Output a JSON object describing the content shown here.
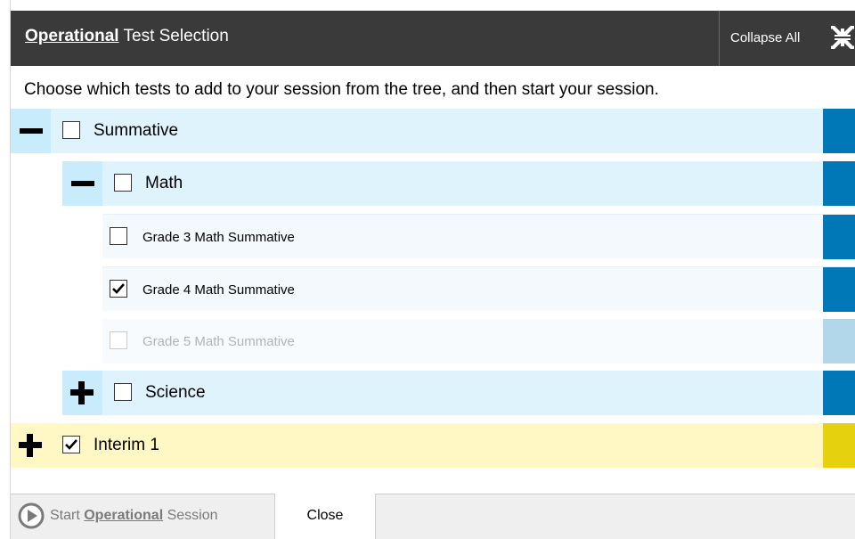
{
  "dialog": {
    "title_strong": "Operational",
    "title_rest": " Test Selection",
    "collapse_all_label": "Collapse All",
    "instructions": "Choose which tests to add to your session from the tree, and then start your session."
  },
  "tree": {
    "summative": {
      "label": "Summative",
      "checked": false,
      "expanded": true
    },
    "math": {
      "label": "Math",
      "checked": false,
      "expanded": true
    },
    "grade3": {
      "label": "Grade 3 Math Summative",
      "checked": false,
      "disabled": false
    },
    "grade4": {
      "label": "Grade 4 Math Summative",
      "checked": true,
      "disabled": false
    },
    "grade5": {
      "label": "Grade 5 Math Summative",
      "checked": false,
      "disabled": true
    },
    "science": {
      "label": "Science",
      "checked": false,
      "expanded": false
    },
    "interim": {
      "label": "Interim 1",
      "checked": true,
      "expanded": false
    }
  },
  "footer": {
    "start_prefix": "Start ",
    "start_strong": "Operational",
    "start_suffix": " Session",
    "close_label": "Close"
  },
  "colors": {
    "header_bg": "#3a3a3a",
    "row_blue": "#dff3fd",
    "scroll_blue": "#0077b6",
    "scroll_blue_disabled": "#b3d7ea",
    "row_yellow": "#fff8c4",
    "scroll_yellow": "#e6d10f"
  },
  "icons": {
    "collapse": "collapse-arrows-icon",
    "start": "play-circle-icon",
    "expand": "plus-icon",
    "collapse_node": "minus-icon",
    "check": "checkmark-icon"
  }
}
